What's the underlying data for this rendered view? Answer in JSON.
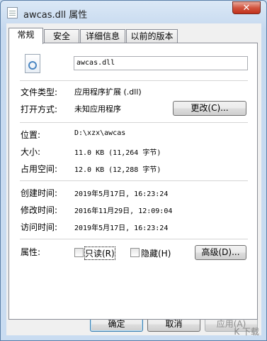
{
  "window": {
    "title": "awcas.dll 属性",
    "close_glyph": "✕"
  },
  "tabs": [
    {
      "label": "常规"
    },
    {
      "label": "安全"
    },
    {
      "label": "详细信息"
    },
    {
      "label": "以前的版本"
    }
  ],
  "general": {
    "file_name": "awcas.dll",
    "file_type_label": "文件类型:",
    "file_type_value": "应用程序扩展 (.dll)",
    "open_with_label": "打开方式:",
    "open_with_value": "未知应用程序",
    "change_button": "更改(C)...",
    "location_label": "位置:",
    "location_value": "D:\\xzx\\awcas",
    "size_label": "大小:",
    "size_value": "11.0 KB (11,264 字节)",
    "size_on_disk_label": "占用空间:",
    "size_on_disk_value": "12.0 KB (12,288 字节)",
    "created_label": "创建时间:",
    "created_value": "2019年5月17日, 16:23:24",
    "modified_label": "修改时间:",
    "modified_value": "2016年11月29日, 12:09:04",
    "accessed_label": "访问时间:",
    "accessed_value": "2019年5月17日, 16:23:24",
    "attributes_label": "属性:",
    "readonly_label": "只读(R)",
    "readonly_checked": false,
    "hidden_label": "隐藏(H)",
    "hidden_checked": false,
    "advanced_button": "高级(D)..."
  },
  "footer": {
    "ok_button": "确定",
    "cancel_button": "取消",
    "apply_button": "应用(A)"
  },
  "watermark": "K 下载"
}
